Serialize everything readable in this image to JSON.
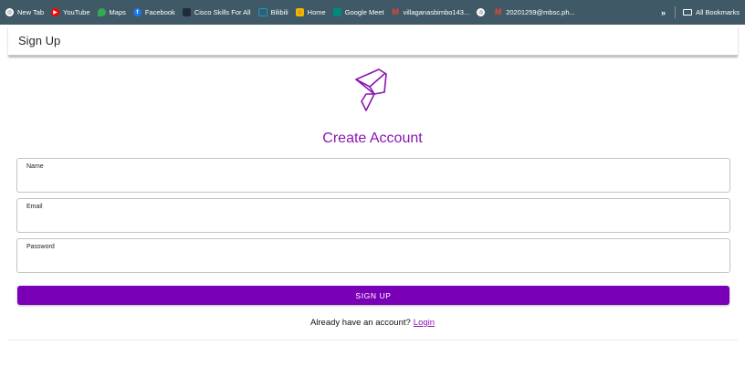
{
  "bookmarks": [
    {
      "label": "New Tab",
      "icon": "chrome-icon",
      "color": "#ffffff"
    },
    {
      "label": "YouTube",
      "icon": "youtube-icon",
      "color": "#ff0000"
    },
    {
      "label": "Maps",
      "icon": "maps-icon",
      "color": "#34a853"
    },
    {
      "label": "Facebook",
      "icon": "facebook-icon",
      "color": "#1877f2"
    },
    {
      "label": "Cisco Skills For All",
      "icon": "cisco-icon",
      "color": "#1f2d3a"
    },
    {
      "label": "Bilibili",
      "icon": "bilibili-icon",
      "color": "#00a1d6"
    },
    {
      "label": "Home",
      "icon": "home-icon",
      "color": "#f4b400"
    },
    {
      "label": "Google Meet",
      "icon": "meet-icon",
      "color": "#00897b"
    },
    {
      "label": "villaganasbimbo143...",
      "icon": "gmail-icon",
      "color": "#ea4335"
    },
    {
      "label": "20201259@mbsc.ph...",
      "icon": "gmail-icon",
      "color": "#ea4335"
    }
  ],
  "bookmarks_more": "»",
  "all_bookmarks": "All Bookmarks",
  "appbar": {
    "title": "Sign Up"
  },
  "form": {
    "heading": "Create Account",
    "name_label": "Name",
    "email_label": "Email",
    "password_label": "Password",
    "name_value": "",
    "email_value": "",
    "password_value": "",
    "submit_label": "SIGN UP"
  },
  "footer": {
    "prompt": "Already have an account?",
    "link": "Login"
  },
  "colors": {
    "accent": "#7a00b8",
    "heading": "#8a15b3",
    "bookmark_bar": "#3f5a66"
  }
}
